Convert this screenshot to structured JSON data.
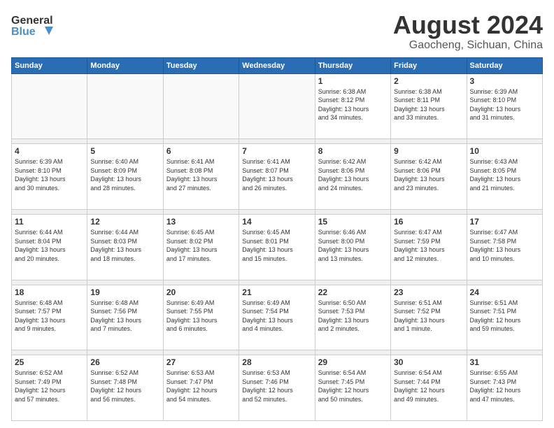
{
  "header": {
    "logo_line1": "General",
    "logo_line2": "Blue",
    "month": "August 2024",
    "location": "Gaocheng, Sichuan, China"
  },
  "weekdays": [
    "Sunday",
    "Monday",
    "Tuesday",
    "Wednesday",
    "Thursday",
    "Friday",
    "Saturday"
  ],
  "weeks": [
    [
      {
        "day": "",
        "info": ""
      },
      {
        "day": "",
        "info": ""
      },
      {
        "day": "",
        "info": ""
      },
      {
        "day": "",
        "info": ""
      },
      {
        "day": "1",
        "info": "Sunrise: 6:38 AM\nSunset: 8:12 PM\nDaylight: 13 hours\nand 34 minutes."
      },
      {
        "day": "2",
        "info": "Sunrise: 6:38 AM\nSunset: 8:11 PM\nDaylight: 13 hours\nand 33 minutes."
      },
      {
        "day": "3",
        "info": "Sunrise: 6:39 AM\nSunset: 8:10 PM\nDaylight: 13 hours\nand 31 minutes."
      }
    ],
    [
      {
        "day": "4",
        "info": "Sunrise: 6:39 AM\nSunset: 8:10 PM\nDaylight: 13 hours\nand 30 minutes."
      },
      {
        "day": "5",
        "info": "Sunrise: 6:40 AM\nSunset: 8:09 PM\nDaylight: 13 hours\nand 28 minutes."
      },
      {
        "day": "6",
        "info": "Sunrise: 6:41 AM\nSunset: 8:08 PM\nDaylight: 13 hours\nand 27 minutes."
      },
      {
        "day": "7",
        "info": "Sunrise: 6:41 AM\nSunset: 8:07 PM\nDaylight: 13 hours\nand 26 minutes."
      },
      {
        "day": "8",
        "info": "Sunrise: 6:42 AM\nSunset: 8:06 PM\nDaylight: 13 hours\nand 24 minutes."
      },
      {
        "day": "9",
        "info": "Sunrise: 6:42 AM\nSunset: 8:06 PM\nDaylight: 13 hours\nand 23 minutes."
      },
      {
        "day": "10",
        "info": "Sunrise: 6:43 AM\nSunset: 8:05 PM\nDaylight: 13 hours\nand 21 minutes."
      }
    ],
    [
      {
        "day": "11",
        "info": "Sunrise: 6:44 AM\nSunset: 8:04 PM\nDaylight: 13 hours\nand 20 minutes."
      },
      {
        "day": "12",
        "info": "Sunrise: 6:44 AM\nSunset: 8:03 PM\nDaylight: 13 hours\nand 18 minutes."
      },
      {
        "day": "13",
        "info": "Sunrise: 6:45 AM\nSunset: 8:02 PM\nDaylight: 13 hours\nand 17 minutes."
      },
      {
        "day": "14",
        "info": "Sunrise: 6:45 AM\nSunset: 8:01 PM\nDaylight: 13 hours\nand 15 minutes."
      },
      {
        "day": "15",
        "info": "Sunrise: 6:46 AM\nSunset: 8:00 PM\nDaylight: 13 hours\nand 13 minutes."
      },
      {
        "day": "16",
        "info": "Sunrise: 6:47 AM\nSunset: 7:59 PM\nDaylight: 13 hours\nand 12 minutes."
      },
      {
        "day": "17",
        "info": "Sunrise: 6:47 AM\nSunset: 7:58 PM\nDaylight: 13 hours\nand 10 minutes."
      }
    ],
    [
      {
        "day": "18",
        "info": "Sunrise: 6:48 AM\nSunset: 7:57 PM\nDaylight: 13 hours\nand 9 minutes."
      },
      {
        "day": "19",
        "info": "Sunrise: 6:48 AM\nSunset: 7:56 PM\nDaylight: 13 hours\nand 7 minutes."
      },
      {
        "day": "20",
        "info": "Sunrise: 6:49 AM\nSunset: 7:55 PM\nDaylight: 13 hours\nand 6 minutes."
      },
      {
        "day": "21",
        "info": "Sunrise: 6:49 AM\nSunset: 7:54 PM\nDaylight: 13 hours\nand 4 minutes."
      },
      {
        "day": "22",
        "info": "Sunrise: 6:50 AM\nSunset: 7:53 PM\nDaylight: 13 hours\nand 2 minutes."
      },
      {
        "day": "23",
        "info": "Sunrise: 6:51 AM\nSunset: 7:52 PM\nDaylight: 13 hours\nand 1 minute."
      },
      {
        "day": "24",
        "info": "Sunrise: 6:51 AM\nSunset: 7:51 PM\nDaylight: 12 hours\nand 59 minutes."
      }
    ],
    [
      {
        "day": "25",
        "info": "Sunrise: 6:52 AM\nSunset: 7:49 PM\nDaylight: 12 hours\nand 57 minutes."
      },
      {
        "day": "26",
        "info": "Sunrise: 6:52 AM\nSunset: 7:48 PM\nDaylight: 12 hours\nand 56 minutes."
      },
      {
        "day": "27",
        "info": "Sunrise: 6:53 AM\nSunset: 7:47 PM\nDaylight: 12 hours\nand 54 minutes."
      },
      {
        "day": "28",
        "info": "Sunrise: 6:53 AM\nSunset: 7:46 PM\nDaylight: 12 hours\nand 52 minutes."
      },
      {
        "day": "29",
        "info": "Sunrise: 6:54 AM\nSunset: 7:45 PM\nDaylight: 12 hours\nand 50 minutes."
      },
      {
        "day": "30",
        "info": "Sunrise: 6:54 AM\nSunset: 7:44 PM\nDaylight: 12 hours\nand 49 minutes."
      },
      {
        "day": "31",
        "info": "Sunrise: 6:55 AM\nSunset: 7:43 PM\nDaylight: 12 hours\nand 47 minutes."
      }
    ]
  ]
}
